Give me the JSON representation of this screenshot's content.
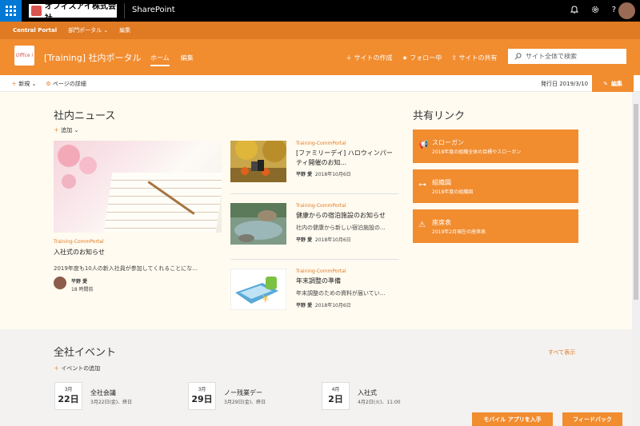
{
  "suite_bar": {
    "brand": "オフィスアイ株式会社",
    "app": "SharePoint",
    "icons": [
      "bell-icon",
      "gear-icon",
      "help-icon"
    ],
    "help_glyph": "?"
  },
  "hub_nav": {
    "title": "Central Portal",
    "items": [
      "部門ポータル",
      "編集"
    ]
  },
  "site_header": {
    "logo_text": "Office i",
    "title": "[Training] 社内ポータル",
    "nav": [
      "ホーム",
      "編集"
    ],
    "actions": [
      "サイトの作成",
      "フォロー中",
      "サイトの共有"
    ],
    "search_placeholder": "サイト全体で検索"
  },
  "command_bar": {
    "new": "新規",
    "page_details": "ページの詳細",
    "published": "発行日 2019/3/10",
    "edit": "編集"
  },
  "news": {
    "heading": "社内ニュース",
    "add": "追加",
    "hero": {
      "source": "Training-CommPortal",
      "title": "入社式のお知らせ",
      "snippet": "2019年度も10人の新入社員が参加してくれることにな...",
      "author": "平野 愛",
      "time": "18 時間前"
    },
    "items": [
      {
        "source": "Training-CommPortal",
        "title1": "[ファミリーデイ] ハロウィンパー",
        "title2": "ティ開催のお知...",
        "snippet": "",
        "author": "平野 愛",
        "date": "2018年10月6日"
      },
      {
        "source": "Training-CommPortal",
        "title1": "健康からの宿泊施設のお知らせ",
        "title2": "",
        "snippet": "社内の健康から新しい宿泊施設の...",
        "author": "平野 愛",
        "date": "2018年10月6日"
      },
      {
        "source": "Training-CommPortal",
        "title1": "年末調整の準備",
        "title2": "",
        "snippet": "年末調整のための資料が届いてい...",
        "author": "平野 愛",
        "date": "2018年10月6日"
      }
    ]
  },
  "quick_links": {
    "heading": "共有リンク",
    "items": [
      {
        "title": "スローガン",
        "sub": "2018年度の組織全体の目標やスローガン",
        "icon": "megaphone-icon"
      },
      {
        "title": "組織図",
        "sub": "2018年度の組織図",
        "icon": "org-chart-icon"
      },
      {
        "title": "座席表",
        "sub": "2019年2月現在の座席表",
        "icon": "warning-icon"
      }
    ]
  },
  "events": {
    "heading": "全社イベント",
    "add": "イベントの追加",
    "show_all": "すべて表示",
    "items": [
      {
        "month": "3月",
        "day": "22日",
        "title": "全社会議",
        "sub": "3月22日(金)、終日"
      },
      {
        "month": "3月",
        "day": "29日",
        "title": "ノー残業デー",
        "sub": "3月29日(金)、終日"
      },
      {
        "month": "4月",
        "day": "2日",
        "title": "入社式",
        "sub": "4月2日(火)、11:00"
      }
    ]
  },
  "floating": {
    "mobile": "モバイル アプリを入手",
    "feedback": "フィードバック"
  },
  "colors": {
    "accent": "#f18c2f",
    "hub": "#e07a23",
    "suite": "#000000",
    "waffle": "#0078d4"
  }
}
